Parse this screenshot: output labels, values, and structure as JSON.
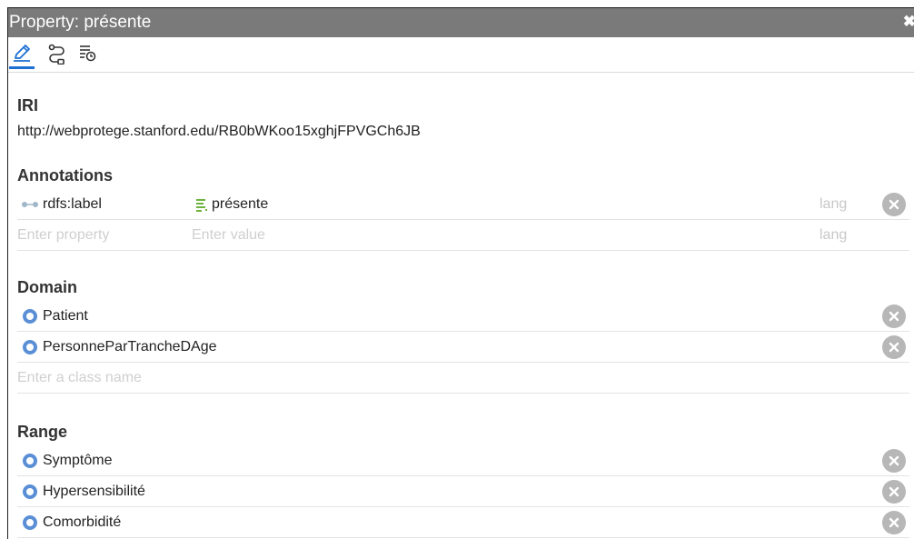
{
  "window": {
    "title": "Property: présente",
    "close_glyph": "✖"
  },
  "toolbar": {
    "tools": [
      {
        "icon": "pencil-edit-icon",
        "active": true
      },
      {
        "icon": "hierarchy-path-icon",
        "active": false
      },
      {
        "icon": "history-list-icon",
        "active": false
      }
    ]
  },
  "iri": {
    "label": "IRI",
    "value": "http://webprotege.stanford.edu/RB0bWKoo15xghjFPVGCh6JB"
  },
  "annotations": {
    "label": "Annotations",
    "rows": [
      {
        "property": "rdfs:label",
        "value": "présente",
        "lang": "lang"
      }
    ],
    "new_row": {
      "property_placeholder": "Enter property",
      "value_placeholder": "Enter value",
      "lang_placeholder": "lang"
    }
  },
  "domain": {
    "label": "Domain",
    "items": [
      "Patient",
      "PersonneParTrancheDAge"
    ],
    "placeholder": "Enter a class name"
  },
  "range": {
    "label": "Range",
    "items": [
      "Symptôme",
      "Hypersensibilité",
      "Comorbidité"
    ]
  },
  "colors": {
    "accent": "#1d6fd1",
    "titlebar": "#7a7a7a",
    "class_icon": "#5a8fd6",
    "remove_button": "#b7b7b7"
  }
}
